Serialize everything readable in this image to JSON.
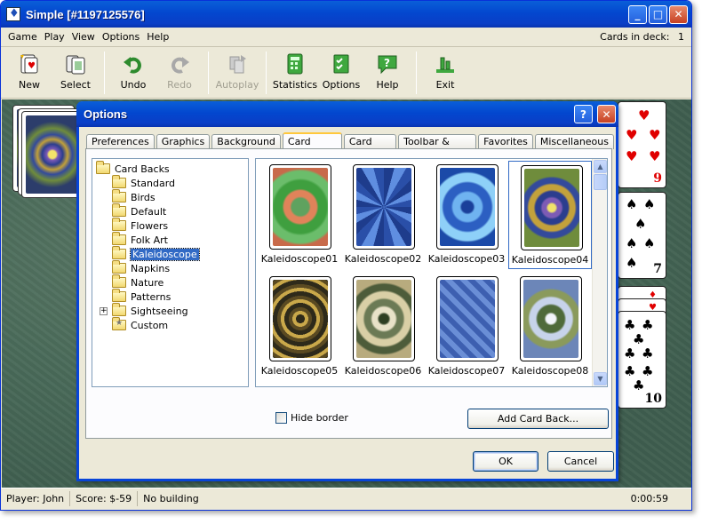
{
  "window": {
    "title": "Simple [#1197125576]",
    "cards_in_deck_label": "Cards in deck:",
    "cards_in_deck": "1"
  },
  "menu": [
    "Game",
    "Play",
    "View",
    "Options",
    "Help"
  ],
  "toolbar": {
    "new": "New",
    "select": "Select",
    "undo": "Undo",
    "redo": "Redo",
    "autoplay": "Autoplay",
    "statistics": "Statistics",
    "options": "Options",
    "help": "Help",
    "exit": "Exit"
  },
  "cards": {
    "top_rank": "9",
    "mid_rank": "7",
    "bottom_rank": "10"
  },
  "status": {
    "player": "Player: John",
    "score": "Score: $-59",
    "building": "No building",
    "time": "0:00:59"
  },
  "dialog": {
    "title": "Options",
    "tabs": [
      "Preferences",
      "Graphics",
      "Background",
      "Card Backs",
      "Card Sets",
      "Toolbar & Menu",
      "Favorites",
      "Miscellaneous"
    ],
    "active_tab": "Card Backs",
    "tree": {
      "root": "Card Backs",
      "items": [
        "Standard",
        "Birds",
        "Default",
        "Flowers",
        "Folk Art",
        "Kaleidoscope",
        "Napkins",
        "Nature",
        "Patterns",
        "Sightseeing",
        "Custom"
      ],
      "selected": "Kaleidoscope"
    },
    "thumbnails": [
      "Kaleidoscope01",
      "Kaleidoscope02",
      "Kaleidoscope03",
      "Kaleidoscope04",
      "Kaleidoscope05",
      "Kaleidoscope06",
      "Kaleidoscope07",
      "Kaleidoscope08"
    ],
    "selected_thumbnail": "Kaleidoscope04",
    "hide_border_label": "Hide border",
    "add_card_back_label": "Add Card Back...",
    "ok_label": "OK",
    "cancel_label": "Cancel"
  },
  "colors": {
    "title_bar": "#0347cf",
    "selection": "#316ac5",
    "felt": "#4a6b5a",
    "tab_highlight": "#ffc83c"
  }
}
